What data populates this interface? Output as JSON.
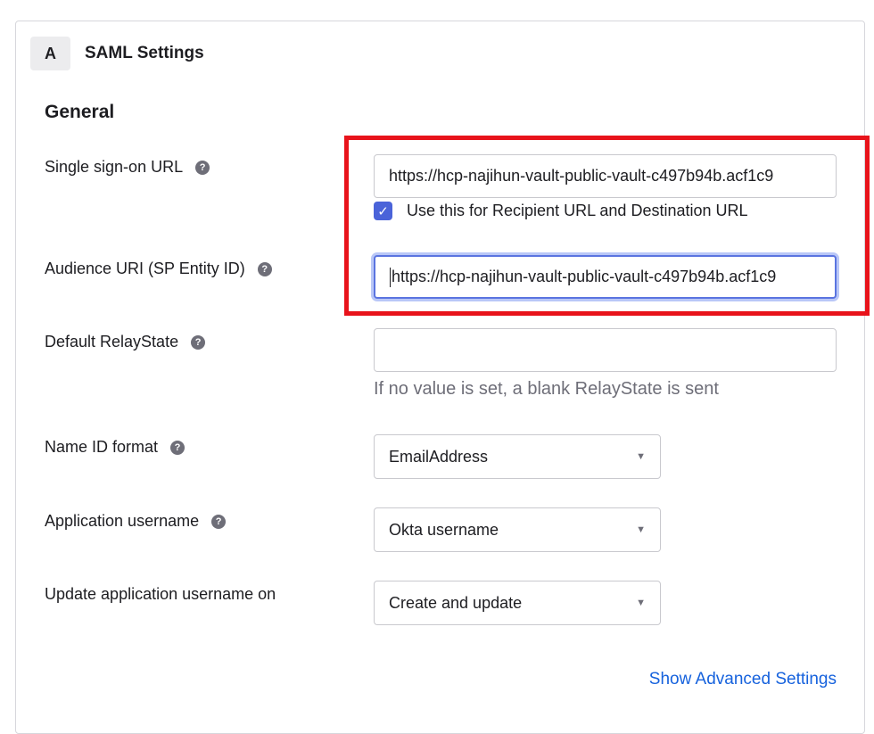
{
  "panel": {
    "step_badge": "A",
    "title": "SAML Settings"
  },
  "general": {
    "title": "General",
    "sso_url": {
      "label": "Single sign-on URL",
      "value": "https://hcp-najihun-vault-public-vault-c497b94b.acf1c9"
    },
    "recipient_checkbox": {
      "checked": true,
      "label": "Use this for Recipient URL and Destination URL"
    },
    "audience_uri": {
      "label": "Audience URI (SP Entity ID)",
      "value": "https://hcp-najihun-vault-public-vault-c497b94b.acf1c9"
    },
    "relay_state": {
      "label": "Default RelayState",
      "value": "",
      "hint": "If no value is set, a blank RelayState is sent"
    },
    "name_id_format": {
      "label": "Name ID format",
      "selected": "EmailAddress"
    },
    "app_username": {
      "label": "Application username",
      "selected": "Okta username"
    },
    "update_username_on": {
      "label": "Update application username on",
      "selected": "Create and update"
    },
    "advanced_link": "Show Advanced Settings"
  },
  "icons": {
    "help": "?",
    "check": "✓",
    "chevron": "▼"
  },
  "colors": {
    "highlight": "#e8131b",
    "accent": "#4a63d9",
    "link": "#1662dd"
  }
}
